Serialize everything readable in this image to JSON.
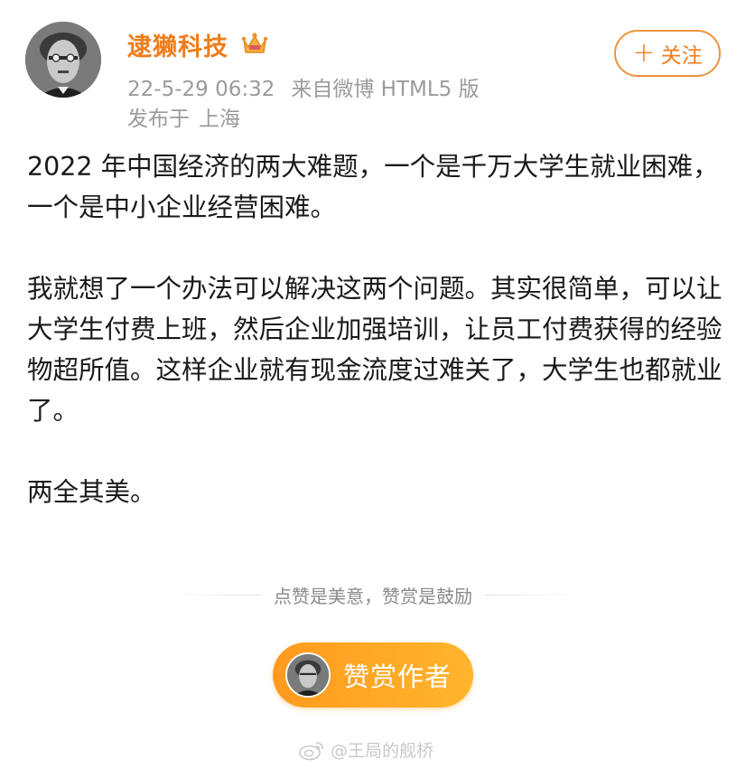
{
  "header": {
    "username": "逮獭科技",
    "crown_icon": "crown-vip-icon",
    "timestamp": "22-5-29 06:32",
    "source": "来自微博 HTML5 版",
    "location_label": "发布于",
    "location": "上海",
    "follow_label": "关注"
  },
  "post": {
    "para1": "2022 年中国经济的两大难题，一个是千万大学生就业困难，一个是中小企业经营困难。",
    "para2": "我就想了一个办法可以解决这两个问题。其实很简单，可以让大学生付费上班，然后企业加强培训，让员工付费获得的经验物超所值。这样企业就有现金流度过难关了，大学生也都就业了。",
    "para3": "两全其美。"
  },
  "reward": {
    "divider_text": "点赞是美意，赞赏是鼓励",
    "button_label": "赞赏作者"
  },
  "watermark": {
    "text": "@王局的舰桥"
  },
  "colors": {
    "accent": "#ef7c1a",
    "meta_gray": "#9b9b9b",
    "reward_gradient_start": "#ff9a1e",
    "reward_gradient_end": "#ffb52d"
  }
}
